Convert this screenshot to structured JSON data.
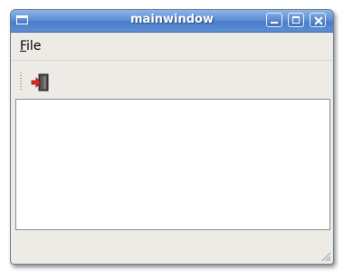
{
  "window": {
    "title": "mainwindow"
  },
  "menubar": {
    "items": [
      {
        "label_mnemonic": "F",
        "label_rest": "ile"
      }
    ]
  },
  "toolbar": {
    "actions": [
      {
        "icon": "exit-icon"
      }
    ]
  },
  "colors": {
    "titlebar": "#5f8fd6",
    "window_bg": "#edebe6",
    "central_bg": "#ffffff"
  }
}
